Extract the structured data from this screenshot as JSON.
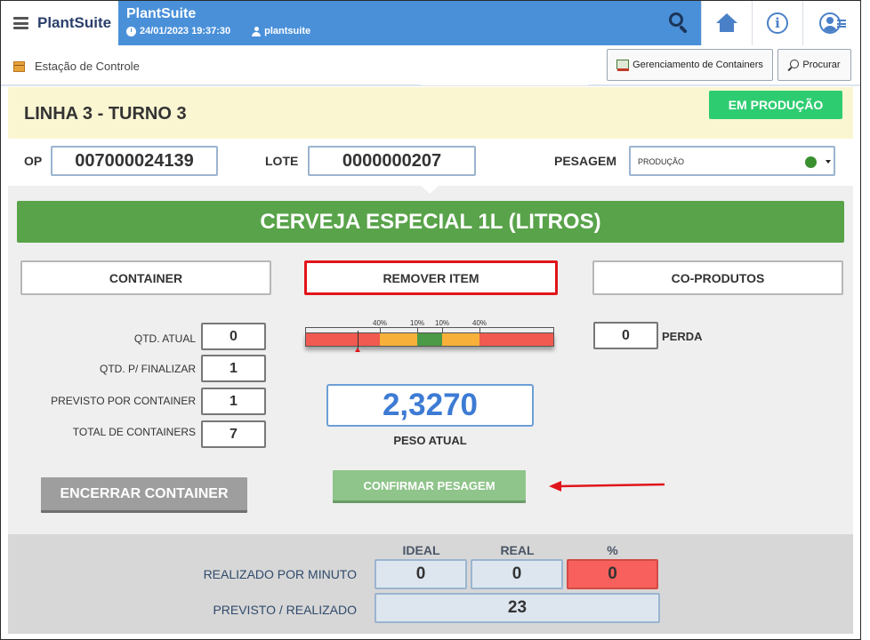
{
  "brand": {
    "name": "PlantSuite"
  },
  "header": {
    "title": "PlantSuite",
    "datetime": "24/01/2023 19:37:30",
    "user": "plantsuite",
    "icons": [
      "search-icon",
      "home-icon",
      "info-icon",
      "user-profile-icon"
    ]
  },
  "subbar": {
    "breadcrumb": "Estação de Controle",
    "containers_button": "Gerenciamento de Containers",
    "search_button": "Procurar"
  },
  "line": {
    "title": "LINHA 3 - TURNO 3",
    "status": "EM PRODUÇÃO"
  },
  "fields": {
    "op_label": "OP",
    "op_value": "007000024139",
    "lote_label": "LOTE",
    "lote_value": "0000000207",
    "pesagem_label": "PESAGEM",
    "pesagem_value": "PRODUÇÃO"
  },
  "product": {
    "name": "CERVEJA ESPECIAL 1L (LITROS)"
  },
  "actions": {
    "container": "CONTAINER",
    "remover": "REMOVER ITEM",
    "coprodutos": "CO-PRODUTOS"
  },
  "quantities": {
    "qtd_atual_label": "QTD. ATUAL",
    "qtd_atual": "0",
    "qtd_finalizar_label": "QTD. P/ FINALIZAR",
    "qtd_finalizar": "1",
    "previsto_label": "PREVISTO POR CONTAINER",
    "previsto": "1",
    "total_label": "TOTAL DE CONTAINERS",
    "total": "7"
  },
  "gauge": {
    "tick_labels": [
      "40%",
      "10%",
      "10%",
      "40%"
    ],
    "zones": [
      {
        "color": "#f15a50",
        "fraction": 0.3
      },
      {
        "color": "#f7b13a",
        "fraction": 0.15
      },
      {
        "color": "#4c9a45",
        "fraction": 0.1
      },
      {
        "color": "#f7b13a",
        "fraction": 0.15
      },
      {
        "color": "#f15a50",
        "fraction": 0.3
      }
    ],
    "needle_fraction": 0.21
  },
  "perda": {
    "value": "0",
    "label": "PERDA"
  },
  "weight": {
    "value": "2,3270",
    "label": "PESO ATUAL"
  },
  "buttons": {
    "encerrar": "ENCERRAR CONTAINER",
    "confirmar": "CONFIRMAR PESAGEM"
  },
  "stats": {
    "col_ideal": "IDEAL",
    "col_real": "REAL",
    "col_pct": "%",
    "row1_label": "REALIZADO POR MINUTO",
    "row1_ideal": "0",
    "row1_real": "0",
    "row1_pct": "0",
    "row2_label": "PREVISTO / REALIZADO",
    "row2_value": "23"
  },
  "colors": {
    "header_blue": "#4a90d9",
    "status_green": "#2ecc71",
    "product_green": "#59a34a",
    "highlight_red": "#e0151b",
    "pct_red": "#f7605c"
  }
}
